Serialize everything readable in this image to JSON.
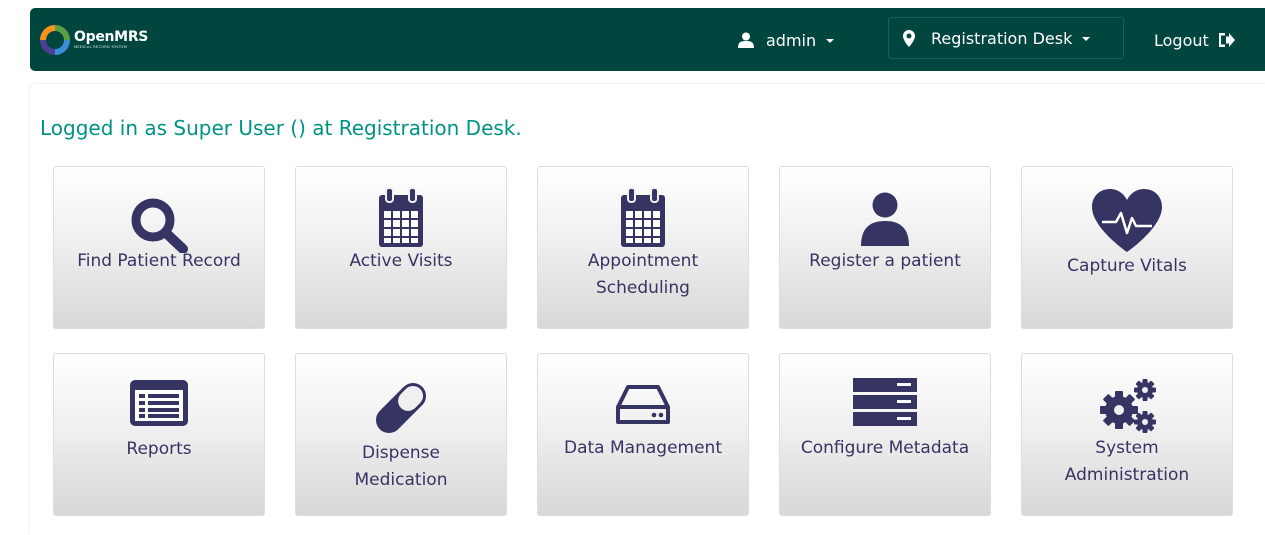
{
  "header": {
    "logo_name": "OpenMRS",
    "logo_tagline": "MEDICAL RECORD SYSTEM",
    "user_label": "admin",
    "location_label": "Registration Desk",
    "logout_label": "Logout"
  },
  "welcome": {
    "text": "Logged in as Super User () at Registration Desk."
  },
  "tiles": [
    {
      "label": "Find Patient Record",
      "icon": "search-icon"
    },
    {
      "label": "Active Visits",
      "icon": "calendar-icon"
    },
    {
      "label": "Appointment Scheduling",
      "icon": "calendar-icon"
    },
    {
      "label": "Register a patient",
      "icon": "user-icon"
    },
    {
      "label": "Capture Vitals",
      "icon": "heartbeat-icon"
    },
    {
      "label": "Reports",
      "icon": "list-alt-icon"
    },
    {
      "label": "Dispense Medication",
      "icon": "pill-icon"
    },
    {
      "label": "Data Management",
      "icon": "hdd-icon"
    },
    {
      "label": "Configure Metadata",
      "icon": "server-icon"
    },
    {
      "label": "System Administration",
      "icon": "cogs-icon"
    }
  ],
  "colors": {
    "header_bg": "#00463f",
    "welcome_text": "#009384",
    "tile_text": "#363463",
    "icon_fill": "#363463",
    "logo_orange": "#f7931e",
    "logo_green": "#5b9f45",
    "logo_blue": "#3a8fd6",
    "logo_purple": "#4a3f91"
  }
}
